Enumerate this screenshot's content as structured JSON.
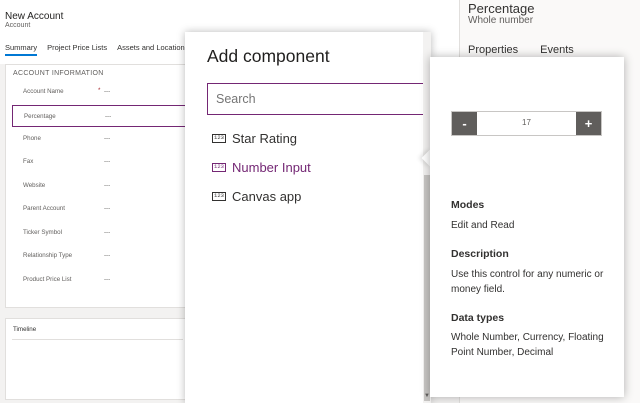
{
  "form": {
    "title": "New Account",
    "entity": "Account",
    "tabs": [
      "Summary",
      "Project Price Lists",
      "Assets and Location"
    ],
    "section_title": "ACCOUNT INFORMATION",
    "required_marker": "*",
    "fields": [
      {
        "label": "Account Name",
        "value": "---"
      },
      {
        "label": "Percentage",
        "value": "---"
      },
      {
        "label": "Phone",
        "value": "---"
      },
      {
        "label": "Fax",
        "value": "---"
      },
      {
        "label": "Website",
        "value": "---"
      },
      {
        "label": "Parent Account",
        "value": "---"
      },
      {
        "label": "Ticker Symbol",
        "value": "---"
      },
      {
        "label": "Relationship Type",
        "value": "---"
      },
      {
        "label": "Product Price List",
        "value": "---"
      }
    ],
    "timeline_title": "Timeline"
  },
  "props": {
    "title": "Percentage",
    "subtitle": "Whole number",
    "tabs": [
      "Properties",
      "Events"
    ]
  },
  "dialog": {
    "title": "Add component",
    "search_placeholder": "Search",
    "icon_text": "123",
    "components": [
      "Star Rating",
      "Number Input",
      "Canvas app"
    ],
    "scroll_down_glyph": "▼"
  },
  "preview": {
    "minus": "-",
    "plus": "+",
    "value": "17",
    "modes_heading": "Modes",
    "modes_text": "Edit and Read",
    "description_heading": "Description",
    "description_text": "Use this control for any numeric or money field.",
    "datatypes_heading": "Data types",
    "datatypes_text": "Whole Number, Currency, Floating Point Number, Decimal"
  },
  "colors": {
    "accent": "#742774",
    "tab_underline": "#0078d4",
    "stepper_button": "#605e5c"
  }
}
